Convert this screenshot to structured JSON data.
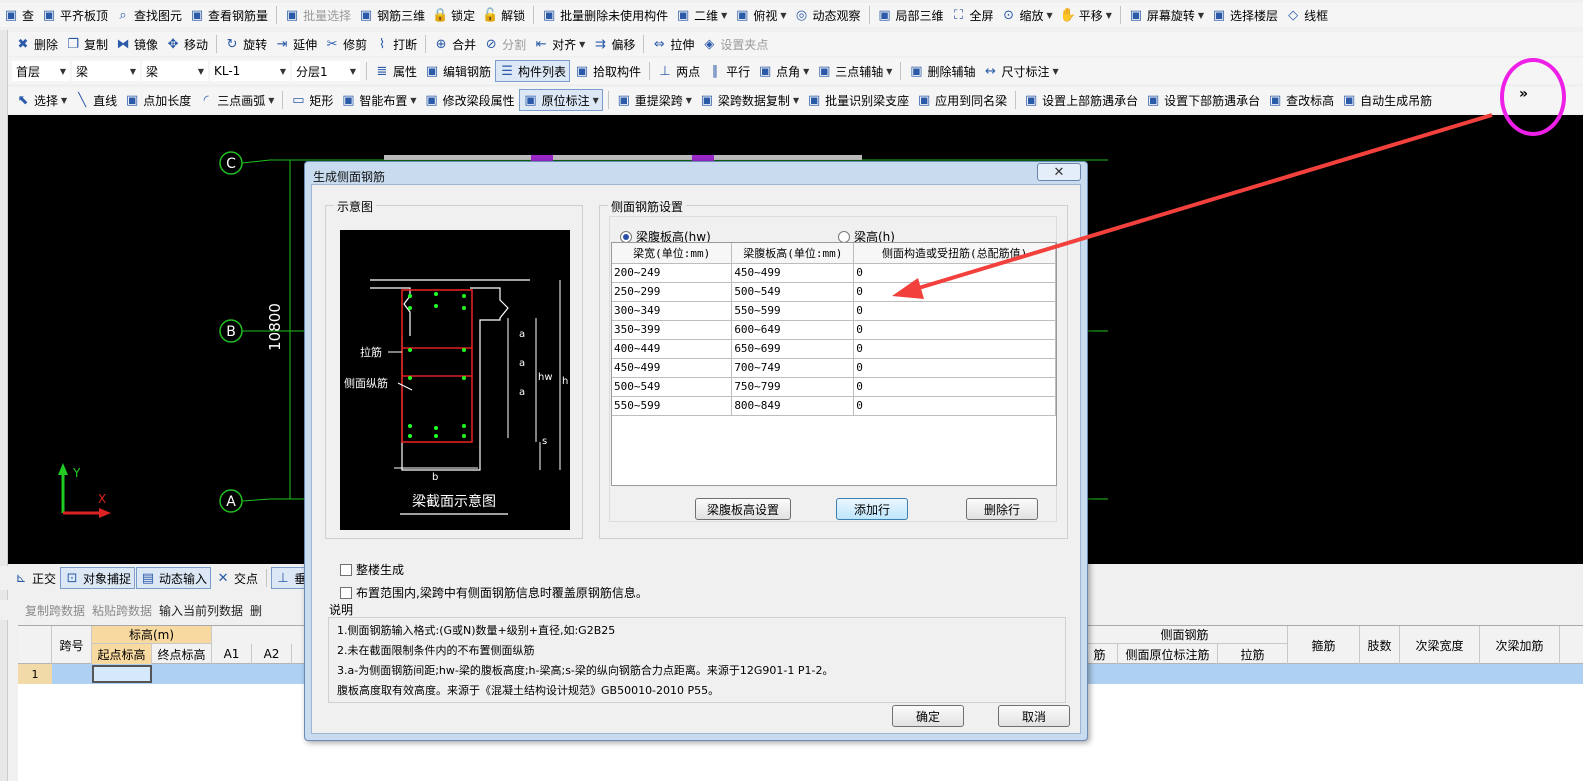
{
  "toolbar1": {
    "items": [
      {
        "label": "查",
        "icon": "partial-icon"
      },
      {
        "label": "平齐板顶",
        "icon": "align-top-icon"
      },
      {
        "label": "查找图元",
        "icon": "find-element-icon"
      },
      {
        "label": "查看钢筋量",
        "icon": "rebar-quantity-icon"
      },
      {
        "label": "批量选择",
        "icon": "batch-select-icon",
        "disabled": true
      },
      {
        "label": "钢筋三维",
        "icon": "rebar-3d-icon"
      },
      {
        "label": "锁定",
        "icon": "lock-icon"
      },
      {
        "label": "解锁",
        "icon": "unlock-icon"
      },
      {
        "label": "批量删除未使用构件",
        "icon": "batch-delete-icon"
      },
      {
        "label": "二维",
        "icon": "2d-view-icon",
        "dropdown": true
      },
      {
        "label": "俯视",
        "icon": "top-view-icon",
        "dropdown": true
      },
      {
        "label": "动态观察",
        "icon": "orbit-icon"
      },
      {
        "label": "局部三维",
        "icon": "local-3d-icon"
      },
      {
        "label": "全屏",
        "icon": "fullscreen-icon"
      },
      {
        "label": "缩放",
        "icon": "zoom-icon",
        "dropdown": true
      },
      {
        "label": "平移",
        "icon": "pan-icon",
        "dropdown": true
      },
      {
        "label": "屏幕旋转",
        "icon": "screen-rotate-icon",
        "dropdown": true
      },
      {
        "label": "选择楼层",
        "icon": "floor-select-icon"
      },
      {
        "label": "线框",
        "icon": "wireframe-icon"
      }
    ]
  },
  "toolbar2": {
    "items": [
      {
        "label": "删除",
        "icon": "delete-icon"
      },
      {
        "label": "复制",
        "icon": "copy-icon"
      },
      {
        "label": "镜像",
        "icon": "mirror-icon"
      },
      {
        "label": "移动",
        "icon": "move-icon"
      },
      {
        "label": "旋转",
        "icon": "rotate-icon"
      },
      {
        "label": "延伸",
        "icon": "extend-icon"
      },
      {
        "label": "修剪",
        "icon": "trim-icon"
      },
      {
        "label": "打断",
        "icon": "break-icon"
      },
      {
        "label": "合并",
        "icon": "merge-icon"
      },
      {
        "label": "分割",
        "icon": "split-icon",
        "disabled": true
      },
      {
        "label": "对齐",
        "icon": "align-icon",
        "dropdown": true
      },
      {
        "label": "偏移",
        "icon": "offset-icon"
      },
      {
        "label": "拉伸",
        "icon": "stretch-icon"
      },
      {
        "label": "设置夹点",
        "icon": "grip-icon",
        "disabled": true
      }
    ]
  },
  "toolbar3": {
    "floor": "首层",
    "category": "梁",
    "type": "梁",
    "component": "KL-1",
    "layer": "分层1",
    "items": [
      {
        "label": "属性",
        "icon": "properties-icon"
      },
      {
        "label": "编辑钢筋",
        "icon": "edit-rebar-icon"
      },
      {
        "label": "构件列表",
        "icon": "component-list-icon",
        "pressed": true
      },
      {
        "label": "拾取构件",
        "icon": "pick-component-icon"
      },
      {
        "label": "两点",
        "icon": "two-point-icon"
      },
      {
        "label": "平行",
        "icon": "parallel-icon"
      },
      {
        "label": "点角",
        "icon": "point-angle-icon",
        "dropdown": true
      },
      {
        "label": "三点辅轴",
        "icon": "three-point-axis-icon",
        "dropdown": true
      },
      {
        "label": "删除辅轴",
        "icon": "delete-axis-icon"
      },
      {
        "label": "尺寸标注",
        "icon": "dimension-icon",
        "dropdown": true
      }
    ]
  },
  "toolbar4": {
    "items": [
      {
        "label": "选择",
        "icon": "select-icon",
        "dropdown": true
      },
      {
        "label": "直线",
        "icon": "line-icon"
      },
      {
        "label": "点加长度",
        "icon": "point-length-icon"
      },
      {
        "label": "三点画弧",
        "icon": "arc-icon",
        "dropdown": true
      },
      {
        "label": "矩形",
        "icon": "rectangle-icon"
      },
      {
        "label": "智能布置",
        "icon": "smart-layout-icon",
        "dropdown": true
      },
      {
        "label": "修改梁段属性",
        "icon": "modify-beam-icon"
      },
      {
        "label": "原位标注",
        "icon": "in-situ-label-icon",
        "dropdown": true,
        "pressed": true
      },
      {
        "label": "重提梁跨",
        "icon": "re-extract-span-icon",
        "dropdown": true
      },
      {
        "label": "梁跨数据复制",
        "icon": "span-copy-icon",
        "dropdown": true
      },
      {
        "label": "批量识别梁支座",
        "icon": "batch-support-icon"
      },
      {
        "label": "应用到同名梁",
        "icon": "apply-same-icon"
      },
      {
        "label": "设置上部筋遇承台",
        "icon": "top-rebar-cap-icon"
      },
      {
        "label": "设置下部筋遇承台",
        "icon": "bottom-rebar-cap-icon"
      },
      {
        "label": "查改标高",
        "icon": "elevation-icon"
      },
      {
        "label": "自动生成吊筋",
        "icon": "hanger-rebar-icon"
      }
    ],
    "overflow": "»"
  },
  "canvas": {
    "axis_labels": [
      "C",
      "B",
      "A"
    ],
    "dimension": "10800",
    "ucs_y": "Y",
    "ucs_x": "X"
  },
  "bottom_toolbar": {
    "items": [
      {
        "label": "正交",
        "icon": "ortho-icon"
      },
      {
        "label": "对象捕捉",
        "icon": "snap-icon",
        "pressed": true
      },
      {
        "label": "动态输入",
        "icon": "dynamic-input-icon",
        "pressed": true
      },
      {
        "label": "交点",
        "icon": "intersection-icon"
      },
      {
        "label": "垂",
        "icon": "perpendicular-icon",
        "pressed": true
      }
    ]
  },
  "grid_toolbar": {
    "items": [
      {
        "label": "复制跨数据",
        "disabled": true
      },
      {
        "label": "粘贴跨数据",
        "disabled": true
      },
      {
        "label": "输入当前列数据",
        "disabled": false
      },
      {
        "label": "删",
        "disabled": false
      }
    ]
  },
  "grid": {
    "col_span": "跨号",
    "group_elevation": "标高(m)",
    "col_start_elev": "起点标高",
    "col_end_elev": "终点标高",
    "col_a1": "A1",
    "col_a2": "A2",
    "col_partial": "",
    "group_side_rebar": "侧面钢筋",
    "col_side_rebar": "筋",
    "col_side_in_situ": "侧面原位标注筋",
    "col_tie": "拉筋",
    "col_stirrup": "箍筋",
    "col_legs": "肢数",
    "col_sub_width": "次梁宽度",
    "col_sub_add": "次梁加筋",
    "row_number": "1"
  },
  "dialog": {
    "title": "生成侧面钢筋",
    "close": "✕",
    "diagram_group": "示意图",
    "diagram_caption": "梁截面示意图",
    "diagram_labels": {
      "tie": "拉筋",
      "side_long": "侧面纵筋",
      "a1": "a",
      "a2": "a",
      "a3": "a",
      "hw": "hw",
      "h": "h",
      "s": "s",
      "b": "b"
    },
    "settings_group": "侧面钢筋设置",
    "radio_hw": "梁腹板高(hw)",
    "radio_h": "梁高(h)",
    "table": {
      "headers": [
        "梁宽(单位:mm)",
        "梁腹板高(单位:mm)",
        "侧面构造或受扭筋(总配筋值)"
      ],
      "rows": [
        [
          "200~249",
          "450~499",
          "0"
        ],
        [
          "250~299",
          "500~549",
          "0"
        ],
        [
          "300~349",
          "550~599",
          "0"
        ],
        [
          "350~399",
          "600~649",
          "0"
        ],
        [
          "400~449",
          "650~699",
          "0"
        ],
        [
          "450~499",
          "700~749",
          "0"
        ],
        [
          "500~549",
          "750~799",
          "0"
        ],
        [
          "550~599",
          "800~849",
          "0"
        ]
      ]
    },
    "btn_web_height": "梁腹板高设置",
    "btn_add_row": "添加行",
    "btn_delete_row": "删除行",
    "chk_whole_building": "整楼生成",
    "chk_overwrite": "布置范围内,梁跨中有侧面钢筋信息时覆盖原钢筋信息。",
    "notes_title": "说明",
    "notes": [
      "1.侧面钢筋输入格式:(G或N)数量+级别+直径,如:G2B25",
      "2.未在截面限制条件内的不布置侧面纵筋",
      "3.a-为侧面钢筋间距;hw-梁的腹板高度;h-梁高;s-梁的纵向钢筋合力点距离。来源于12G901-1 P1-2。",
      "  腹板高度取有效高度。来源于《混凝土结构设计规范》GB50010-2010 P55。"
    ],
    "btn_ok": "确定",
    "btn_cancel": "取消"
  },
  "colors": {
    "annotation": "#ee20e8",
    "arrow": "#f2403c",
    "axis_green": "#1fbf1f",
    "rebar_red": "#e02020",
    "rebar_dot": "#22ff22"
  },
  "icon_glyphs": {
    "default": "▣"
  }
}
